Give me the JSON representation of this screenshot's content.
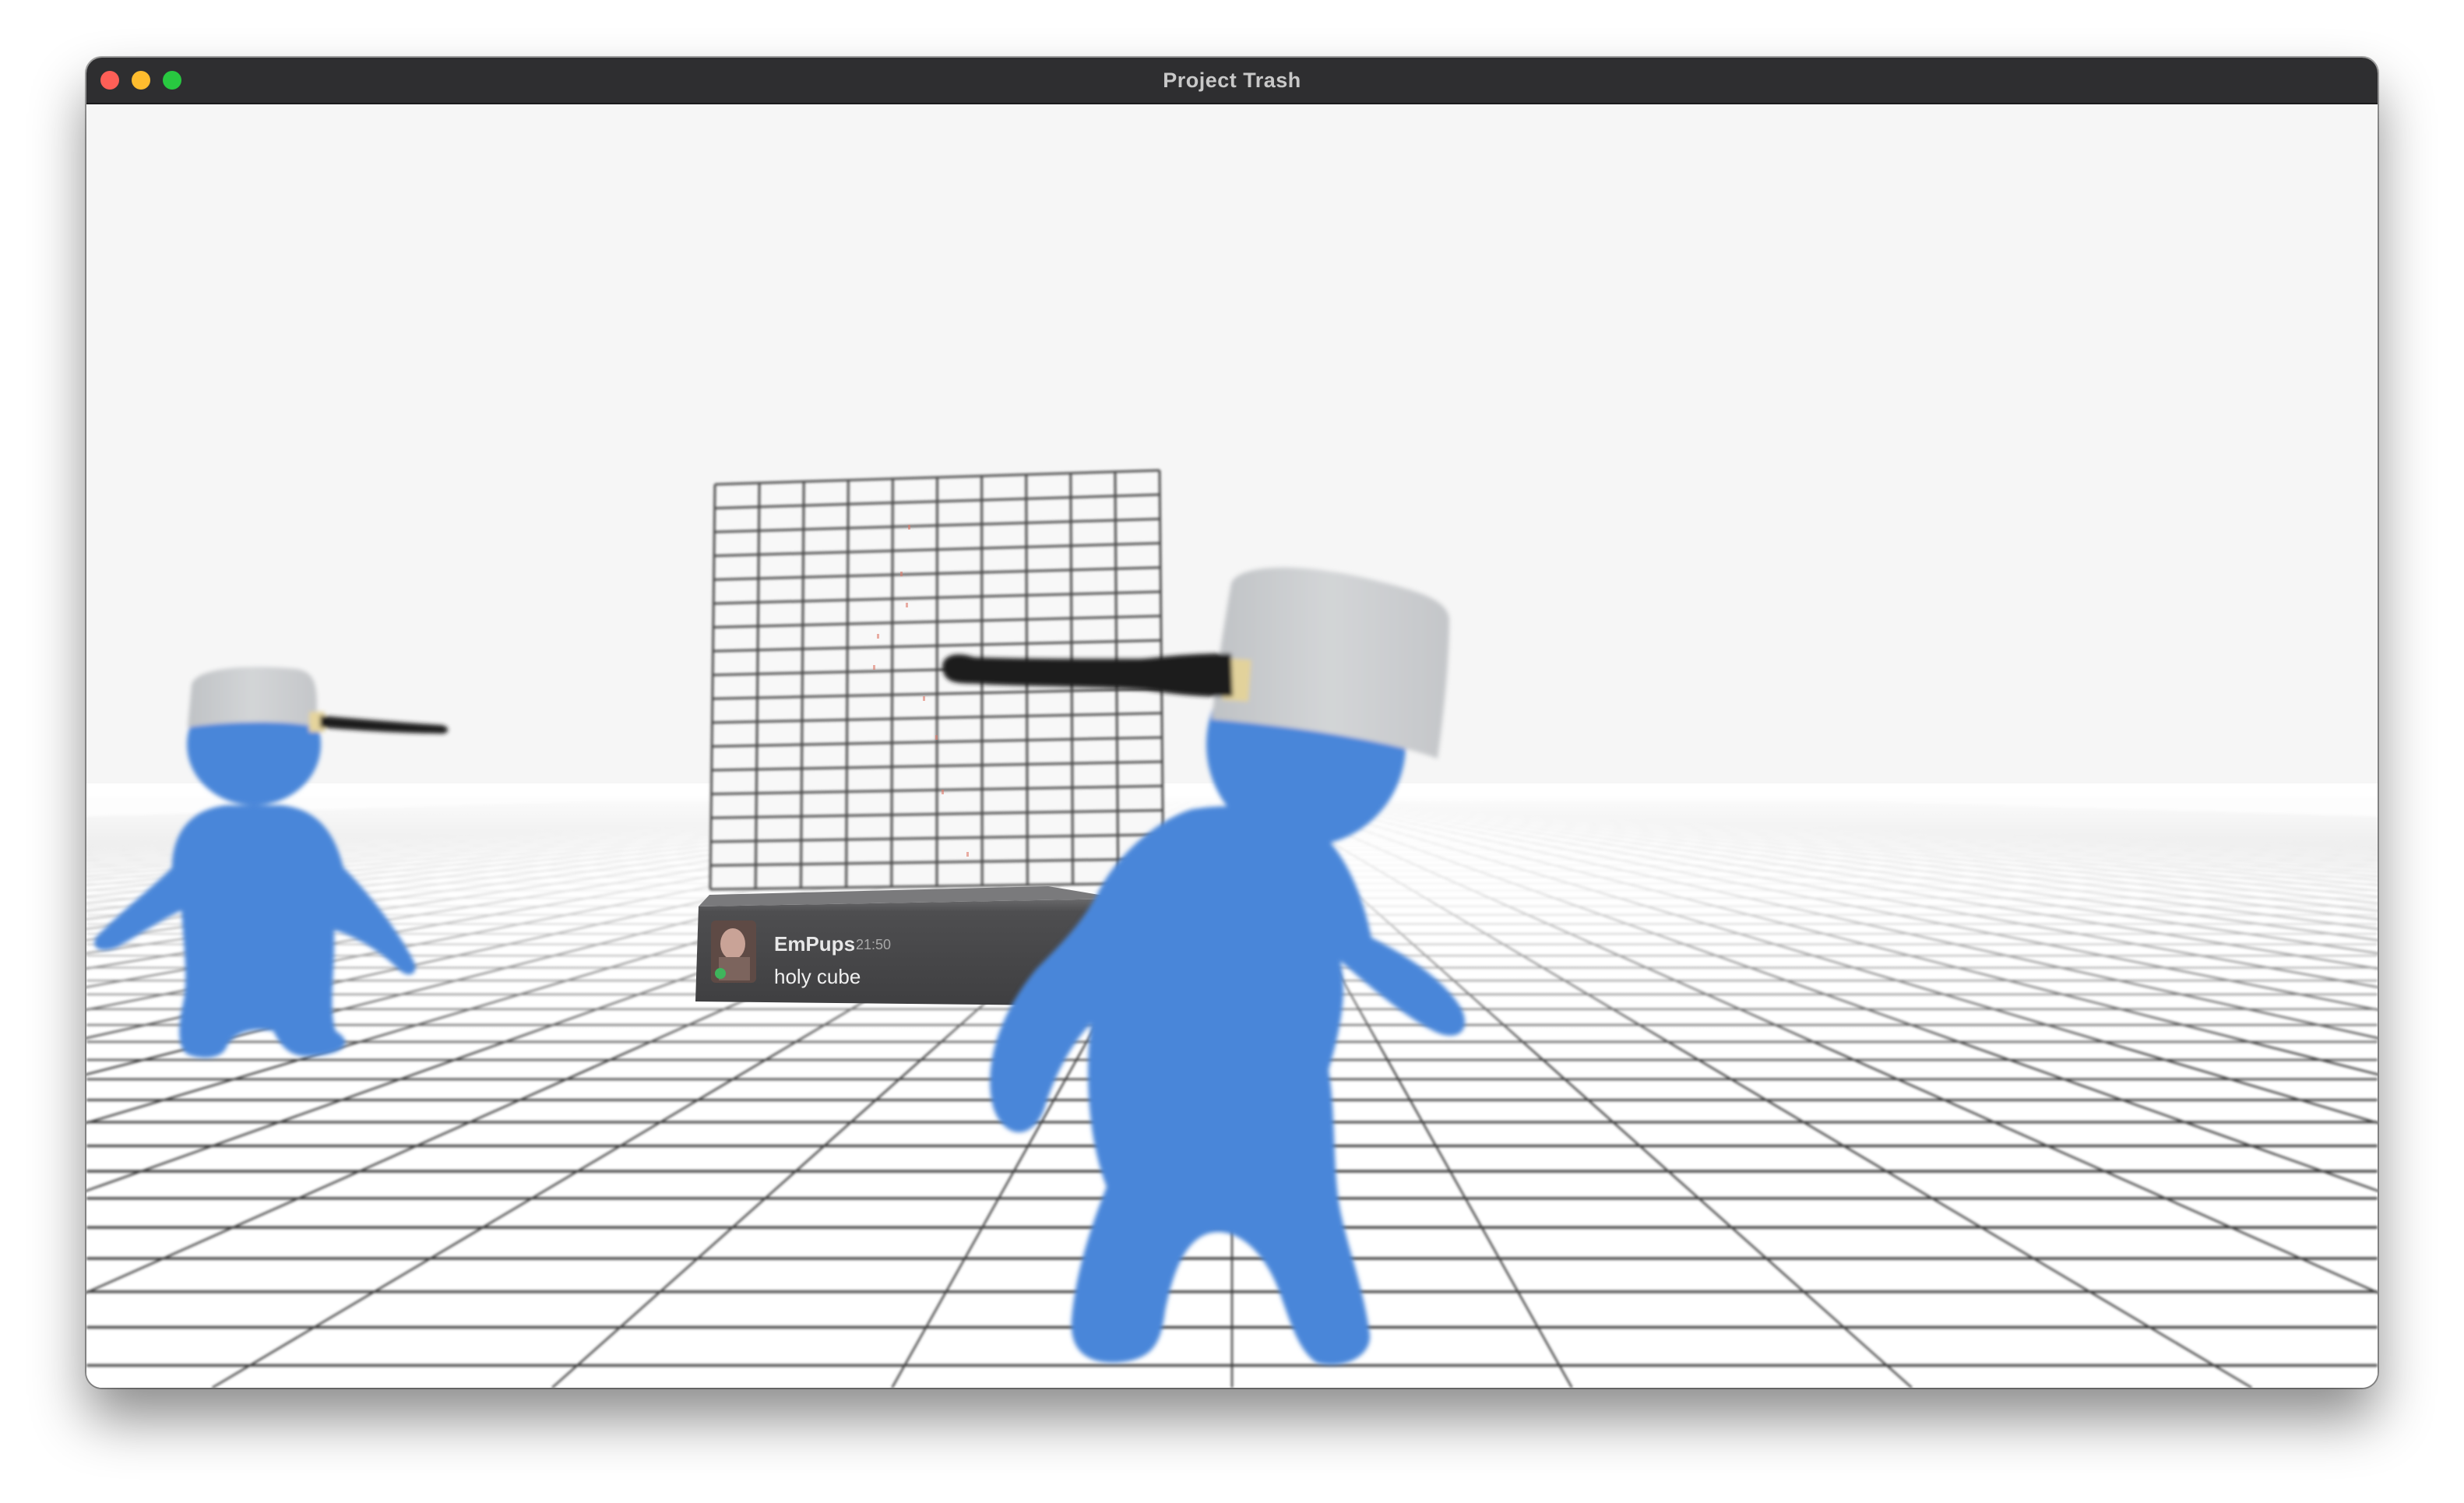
{
  "window": {
    "title": "Project Trash",
    "traffic_lights": {
      "close": "#fe5f57",
      "minimize": "#febc2e",
      "maximize": "#28c840"
    }
  },
  "scene": {
    "sky_color": "#f6f6f6",
    "floor_color": "#ffffff",
    "grid_line_color": "#333333",
    "character_color": "#4a86d9",
    "hat_color": "#c9cbcd"
  },
  "chat_panel": {
    "username": "EmPups",
    "timestamp": "21:50",
    "message": "holy cube"
  }
}
